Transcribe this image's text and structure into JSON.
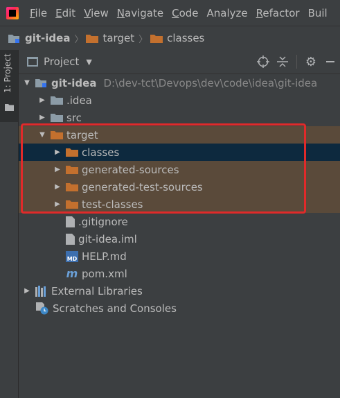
{
  "menu": {
    "items": [
      "File",
      "Edit",
      "View",
      "Navigate",
      "Code",
      "Analyze",
      "Refactor",
      "Buil"
    ],
    "mnemonics": [
      0,
      0,
      0,
      0,
      0,
      null,
      0,
      null
    ]
  },
  "breadcrumb": [
    "git-idea",
    "target",
    "classes"
  ],
  "stripe": {
    "label": "1: Project"
  },
  "panel": {
    "title": "Project"
  },
  "tree": [
    {
      "label": "git-idea",
      "path": "D:\\dev-tct\\Devops\\dev\\code\\idea\\git-idea",
      "indent": 0,
      "arrow": "down",
      "icon": "module",
      "bold": true
    },
    {
      "label": ".idea",
      "indent": 1,
      "arrow": "right",
      "icon": "folder-gray"
    },
    {
      "label": "src",
      "indent": 1,
      "arrow": "right",
      "icon": "folder-gray"
    },
    {
      "label": "target",
      "indent": 1,
      "arrow": "down",
      "icon": "folder-orange",
      "group": true
    },
    {
      "label": "classes",
      "indent": 2,
      "arrow": "right",
      "icon": "folder-orange",
      "selected": true
    },
    {
      "label": "generated-sources",
      "indent": 2,
      "arrow": "right",
      "icon": "folder-orange",
      "group": true
    },
    {
      "label": "generated-test-sources",
      "indent": 2,
      "arrow": "right",
      "icon": "folder-orange",
      "group": true
    },
    {
      "label": "test-classes",
      "indent": 2,
      "arrow": "right",
      "icon": "folder-orange",
      "group": true
    },
    {
      "label": ".gitignore",
      "indent": 2,
      "arrow": "",
      "icon": "file"
    },
    {
      "label": "git-idea.iml",
      "indent": 2,
      "arrow": "",
      "icon": "file"
    },
    {
      "label": "HELP.md",
      "indent": 2,
      "arrow": "",
      "icon": "markdown"
    },
    {
      "label": "pom.xml",
      "indent": 2,
      "arrow": "",
      "icon": "maven"
    },
    {
      "label": "External Libraries",
      "indent": 0,
      "arrow": "right",
      "icon": "libraries"
    },
    {
      "label": "Scratches and Consoles",
      "indent": 0,
      "arrow": "",
      "icon": "scratches"
    }
  ],
  "colors": {
    "background": "#3c3f41",
    "selection": "#0d293e",
    "group_highlight": "#5a4a3a",
    "highlight_border": "#e02a2a",
    "folder_orange": "#c3702e",
    "folder_gray": "#8c9ca7"
  }
}
